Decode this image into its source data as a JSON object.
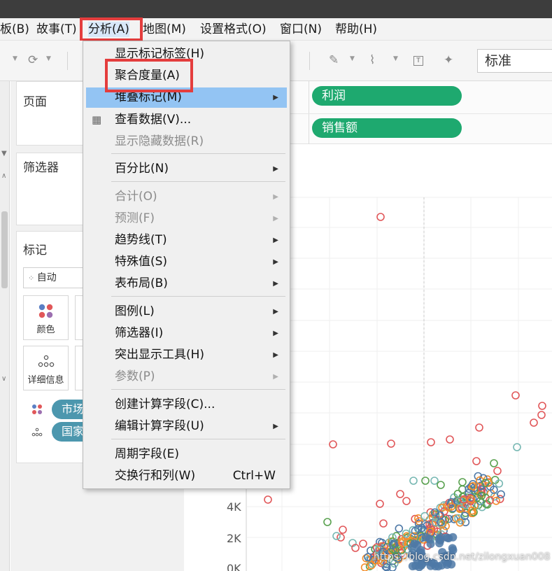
{
  "menubar": {
    "items": [
      "板(B)",
      "故事(T)",
      "分析(A)",
      "地图(M)",
      "设置格式(O)",
      "窗口(N)",
      "帮助(H)"
    ]
  },
  "toolbar": {
    "zoom_select": "标准"
  },
  "shelves": {
    "pages_title": "页面",
    "filters_title": "筛选器",
    "marks_title": "标记",
    "mark_type": "自动",
    "color_label": "颜色",
    "detail_label": "详细信息",
    "pill_1": "市场",
    "pill_2": "国家"
  },
  "rows_shelf": {
    "pill_top": "利润",
    "pill_bottom": "销售额"
  },
  "dropdown": {
    "items": [
      {
        "label": "显示标记标签(H)",
        "enabled": true,
        "submenu": false
      },
      {
        "label": "聚合度量(A)",
        "enabled": true,
        "submenu": false
      },
      {
        "label": "堆叠标记(M)",
        "enabled": true,
        "submenu": true
      },
      {
        "label": "查看数据(V)...",
        "enabled": true,
        "submenu": false
      },
      {
        "label": "显示隐藏数据(R)",
        "enabled": false,
        "submenu": false
      },
      {
        "label": "百分比(N)",
        "enabled": true,
        "submenu": true
      },
      {
        "label": "合计(O)",
        "enabled": false,
        "submenu": true
      },
      {
        "label": "预测(F)",
        "enabled": false,
        "submenu": true
      },
      {
        "label": "趋势线(T)",
        "enabled": true,
        "submenu": true
      },
      {
        "label": "特殊值(S)",
        "enabled": true,
        "submenu": true
      },
      {
        "label": "表布局(B)",
        "enabled": true,
        "submenu": true
      },
      {
        "label": "图例(L)",
        "enabled": true,
        "submenu": true
      },
      {
        "label": "筛选器(I)",
        "enabled": true,
        "submenu": true
      },
      {
        "label": "突出显示工具(H)",
        "enabled": true,
        "submenu": true
      },
      {
        "label": "参数(P)",
        "enabled": false,
        "submenu": true
      },
      {
        "label": "创建计算字段(C)...",
        "enabled": true,
        "submenu": false
      },
      {
        "label": "编辑计算字段(U)",
        "enabled": true,
        "submenu": true
      },
      {
        "label": "周期字段(E)",
        "enabled": true,
        "submenu": false
      },
      {
        "label": "交换行和列(W)",
        "enabled": true,
        "submenu": false,
        "shortcut": "Ctrl+W"
      }
    ]
  },
  "axis": {
    "y_ticks": [
      "4K",
      "2K",
      "0K"
    ]
  },
  "watermark": "https://blog.csdn.net/zilongxuan008",
  "colors": {
    "accent_red": "#e43d3d",
    "pill_green": "#1ea96f",
    "pill_teal": "#4c97ae",
    "highlight": "#93c4f3",
    "series_red": "#e15759",
    "series_green": "#59a14f",
    "series_teal": "#76b7b2",
    "series_orange": "#f28e2b",
    "series_blue": "#4e79a7"
  }
}
